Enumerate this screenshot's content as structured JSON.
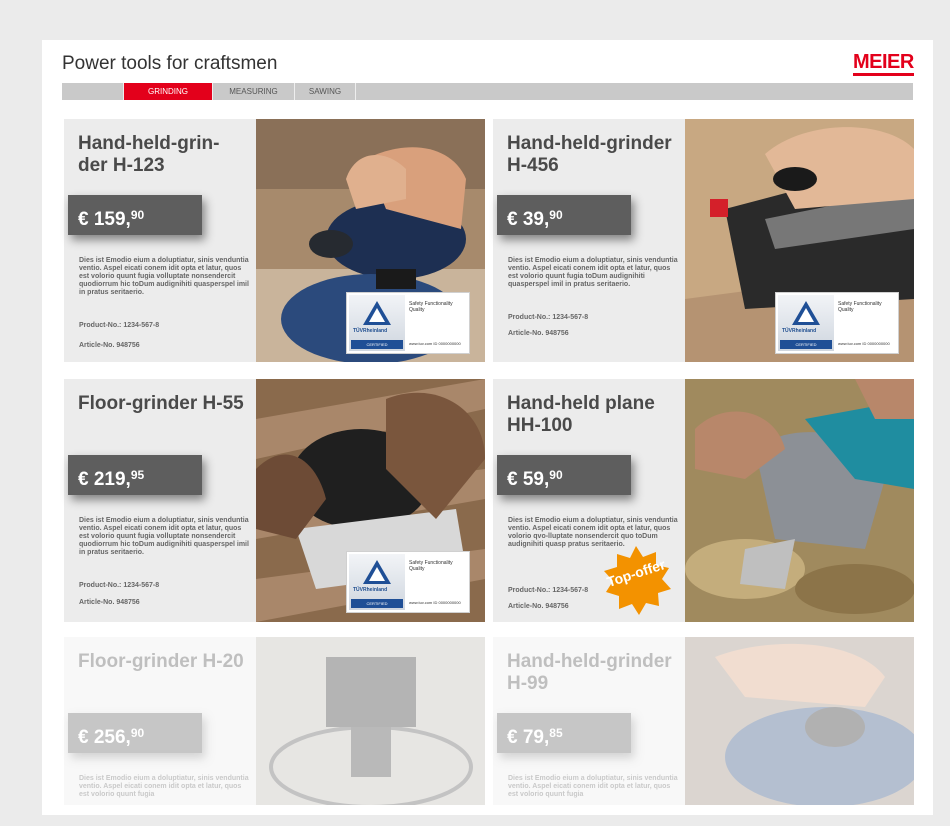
{
  "header": {
    "title": "Power tools for craftsmen",
    "logo": "MEIER"
  },
  "nav": {
    "items": [
      "",
      "GRINDING",
      "MEASURING",
      "SAWING"
    ],
    "active_index": 1
  },
  "products": [
    {
      "title": "Hand-held-grin-der H-123",
      "price_main": "€ 159,",
      "price_cents": "90",
      "description": "Dies ist Emodio eium a doluptiatur, sinis venduntia ventio. Aspel eicati conem idit opta et latur, quos est volorio quunt fugia volluptate nonsendercit quodiorrum hic toDum audignihiti quasperspel imil in pratus seritaerio.",
      "product_no": "Product-No.: 1234-567-8",
      "article_no": "Article-No. 948756"
    },
    {
      "title": "Hand-held-grinder H-456",
      "price_main": "€ 39,",
      "price_cents": "90",
      "description": "Dies ist Emodio eium a doluptiatur, sinis venduntia ventio. Aspel eicati conem idit opta et latur, quos est volorio quunt fugia toDum audignihiti quasperspel imil in pratus seritaerio.",
      "product_no": "Product-No.: 1234-567-8",
      "article_no": "Article-No. 948756"
    },
    {
      "title": "Floor-grinder H-55",
      "price_main": "€ 219,",
      "price_cents": "95",
      "description": "Dies ist Emodio eium a doluptiatur, sinis venduntia ventio. Aspel eicati conem idit opta et latur, quos est volorio quunt fugia volluptate nonsendercit quodiorrum hic toDum audignihiti quasperspel imil in pratus seritaerio.",
      "product_no": "Product-No.: 1234-567-8",
      "article_no": "Article-No. 948756"
    },
    {
      "title": "Hand-held plane HH-100",
      "price_main": "€ 59,",
      "price_cents": "90",
      "description": "Dies ist Emodio eium a doluptiatur, sinis venduntia ventio. Aspel eicati conem idit opta et latur, quos volorio qvo-lluptate nonsendercit quo toDum audignihiti quasp pratus seritaerio.",
      "product_no": "Product-No.: 1234-567-8",
      "article_no": "Article-No. 948756",
      "badge": "Top-offer"
    },
    {
      "title": "Floor-grinder H-20",
      "price_main": "€ 256,",
      "price_cents": "90",
      "description": "Dies ist Emodio eium a doluptiatur, sinis venduntia ventio. Aspel eicati conem idit opta et latur, quos est volorio quunt fugia"
    },
    {
      "title": "Hand-held-grinder H-99",
      "price_main": "€ 79,",
      "price_cents": "85",
      "description": "Dies ist Emodio eium a doluptiatur, sinis venduntia ventio. Aspel eicati conem idit opta et latur, quos est volorio quunt fugia"
    }
  ],
  "certificate": {
    "name": "TÜVRheinland",
    "certified": "CERTIFIED",
    "lines": "Safety Functionality Quality",
    "www": "www.tuv.com ID 0000000000"
  },
  "colors": {
    "brand": "#e3001b",
    "price_bg": "#5e5e5e",
    "card_bg": "#ececec",
    "badge": "#f39200",
    "tuv_blue": "#1f4f96"
  }
}
